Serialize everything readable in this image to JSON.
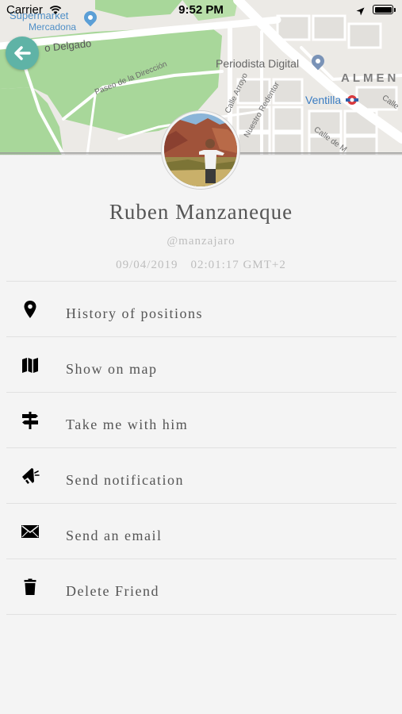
{
  "status_bar": {
    "carrier": "Carrier",
    "time": "9:52 PM"
  },
  "map": {
    "labels": {
      "supermarket_line1": "Supermarket",
      "supermarket_line2": "Mercadona",
      "street_delgado": "o Delgado",
      "periodista": "Periodista Digital",
      "almen": "ALMEN",
      "ventilla": "Ventilla",
      "paseo": "Paseo de la Dirección",
      "arroyo": "Calle Arroyo",
      "redentor": "Nuestro Redentor",
      "calle_de_m": "Calle de M",
      "calle_short": "Calle"
    },
    "colors": {
      "land": "#eceae6",
      "park": "#a8d79a",
      "road": "#ffffff",
      "poi": "#5b9fd6",
      "metro": "#d9393e"
    }
  },
  "profile": {
    "name": "Ruben Manzaneque",
    "username": "@manzajaro",
    "date": "09/04/2019",
    "time": "02:01:17 GMT+2"
  },
  "menu": {
    "items": [
      {
        "label": "History of positions",
        "icon": "map-pin-icon"
      },
      {
        "label": "Show on map",
        "icon": "map-icon"
      },
      {
        "label": "Take me with him",
        "icon": "signpost-icon"
      },
      {
        "label": "Send notification",
        "icon": "megaphone-icon"
      },
      {
        "label": "Send an email",
        "icon": "envelope-icon"
      },
      {
        "label": "Delete Friend",
        "icon": "trash-icon"
      }
    ]
  },
  "colors": {
    "accent": "#5fb3a6",
    "background": "#f4f4f4",
    "text": "#555555",
    "muted_text": "#bdbdbd",
    "divider": "#e1e1e1"
  }
}
